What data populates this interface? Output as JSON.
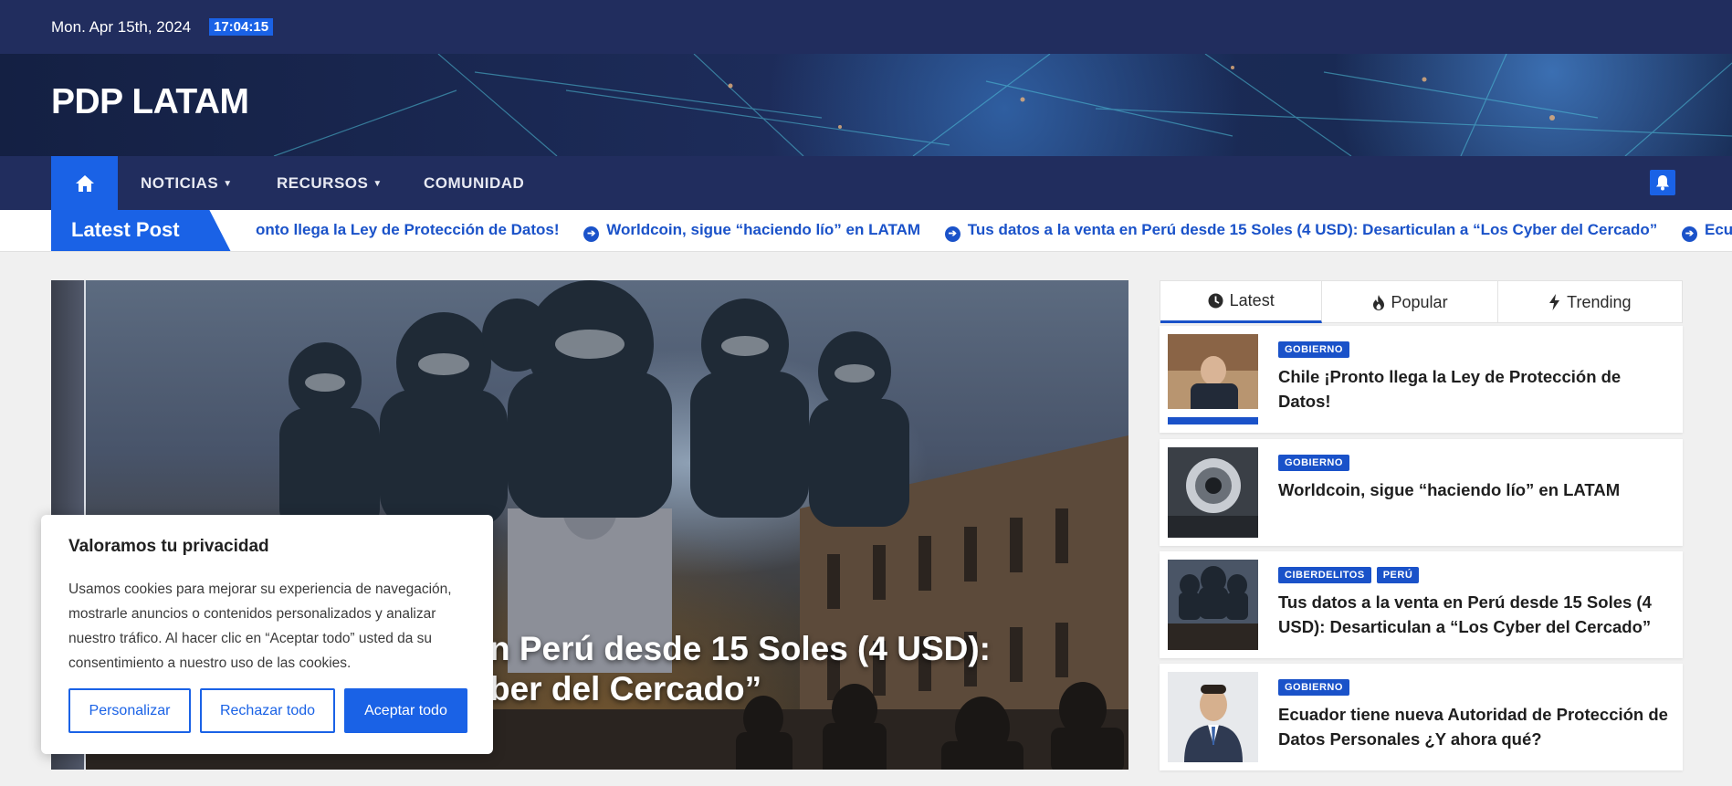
{
  "topbar": {
    "date": "Mon. Apr 15th, 2024",
    "time": "17:04:15"
  },
  "site": {
    "brand": "PDP LATAM"
  },
  "nav": {
    "home_icon": "home-icon",
    "items": [
      {
        "label": "NOTICIAS",
        "has_caret": true
      },
      {
        "label": "RECURSOS",
        "has_caret": true
      },
      {
        "label": "COMUNIDAD",
        "has_caret": false
      }
    ],
    "bell_icon": "bell-icon"
  },
  "ticker": {
    "label": "Latest Post",
    "items": [
      "onto llega la Ley de Protección de Datos!",
      "Worldcoin, sigue “haciendo lío” en LATAM",
      "Tus datos a la venta en Perú desde 15 Soles (4 USD): Desarticulan a “Los Cyber del Cercado”",
      "Ecuador tie"
    ]
  },
  "hero": {
    "headline": "n Perú desde 15 Soles (4 USD):\nber del Cercado”"
  },
  "cookie": {
    "title": "Valoramos tu privacidad",
    "text": "Usamos cookies para mejorar su experiencia de navegación, mostrarle anuncios o contenidos personalizados y analizar nuestro tráfico. Al hacer clic en “Aceptar todo” usted da su consentimiento a nuestro uso de las cookies.",
    "customize": "Personalizar",
    "reject": "Rechazar todo",
    "accept": "Aceptar todo"
  },
  "sidebar": {
    "tabs": [
      {
        "label": "Latest",
        "icon": "clock-icon"
      },
      {
        "label": "Popular",
        "icon": "fire-icon"
      },
      {
        "label": "Trending",
        "icon": "bolt-icon"
      }
    ],
    "posts": [
      {
        "cats": [
          "GOBIERNO"
        ],
        "title": "Chile ¡Pronto llega la Ley de Protección de Datos!"
      },
      {
        "cats": [
          "GOBIERNO"
        ],
        "title": "Worldcoin, sigue “haciendo lío” en LATAM"
      },
      {
        "cats": [
          "CIBERDELITOS",
          "PERÚ"
        ],
        "title": "Tus datos a la venta en Perú desde 15 Soles (4 USD): Desarticulan a “Los Cyber del Cercado”"
      },
      {
        "cats": [
          "GOBIERNO"
        ],
        "title": "Ecuador tiene nueva Autoridad de Protección de Datos Personales ¿Y ahora qué?"
      }
    ]
  },
  "colors": {
    "navy": "#212d5e",
    "accent": "#1a62e6",
    "link": "#1a52c9"
  }
}
